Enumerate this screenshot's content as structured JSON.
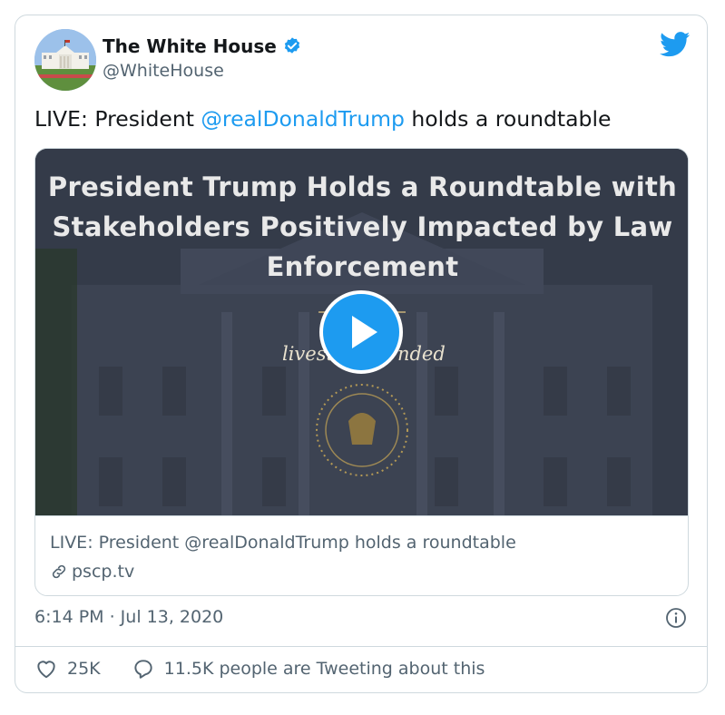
{
  "author": {
    "name": "The White House",
    "handle": "@WhiteHouse",
    "verified_icon": "verified-badge-icon",
    "avatar": "white-house-photo"
  },
  "brand_icon": "twitter-bird-icon",
  "tweet": {
    "text_prefix": "LIVE: President ",
    "mention": "@realDonaldTrump",
    "text_suffix": " holds a roundtable"
  },
  "media": {
    "title_line1": "President Trump Holds a Roundtable with",
    "title_line2": "Stakeholders Positively Impacted by Law",
    "title_line3": "Enforcement",
    "overlay_left": "livest",
    "overlay_right": "nded",
    "play_icon": "play-icon",
    "seal": "presidential-seal"
  },
  "link_card": {
    "title": "LIVE: President @realDonaldTrump holds a roundtable",
    "domain": "pscp.tv",
    "link_icon": "link-icon"
  },
  "timestamp": "6:14 PM · Jul 13, 2020",
  "info_icon": "info-icon",
  "actions": {
    "likes": "25K",
    "like_icon": "heart-icon",
    "conversation": "11.5K people are Tweeting about this",
    "reply_icon": "speech-bubble-icon"
  },
  "colors": {
    "accent": "#1d9bf0",
    "secondary_text": "#536471",
    "border": "#cfd9de"
  }
}
